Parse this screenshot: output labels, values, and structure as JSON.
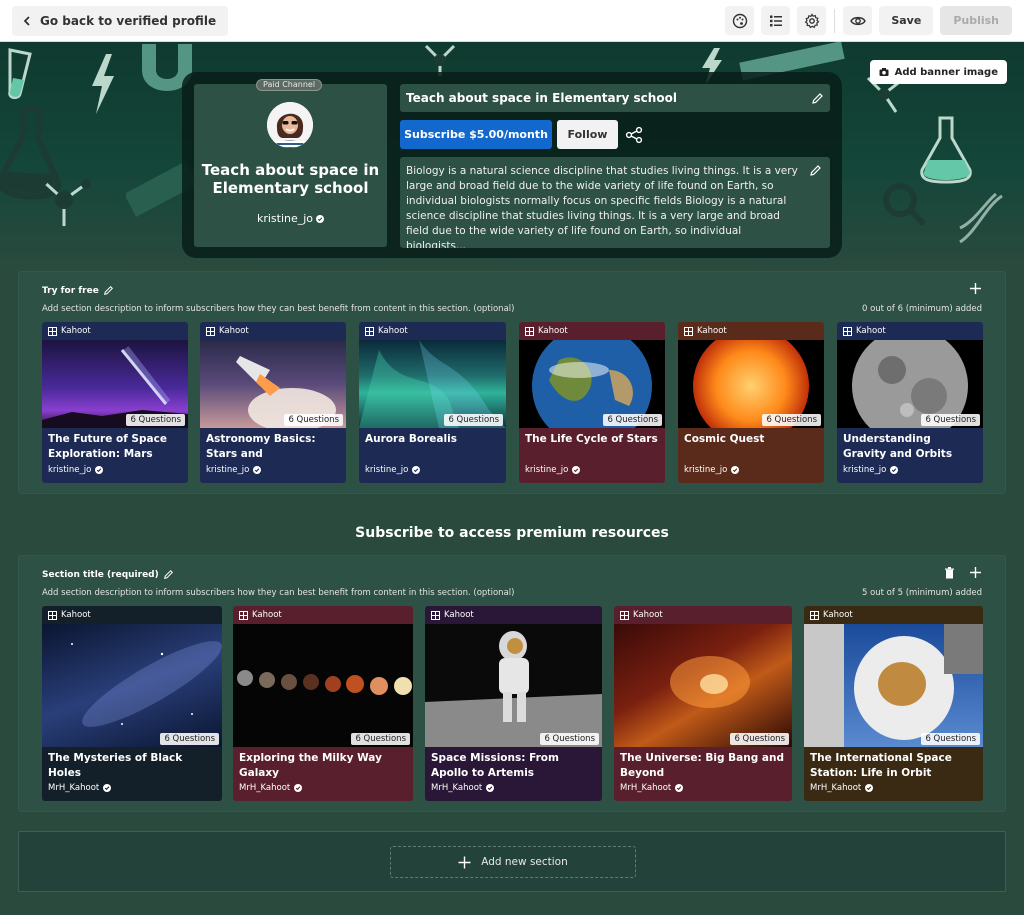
{
  "topbar": {
    "back_label": "Go back to verified profile",
    "save_label": "Save",
    "publish_label": "Publish"
  },
  "banner": {
    "add_banner_label": "Add banner image"
  },
  "channel": {
    "paid_pill": "Paid Channel",
    "title": "Teach about space in Elementary school",
    "author": "kristine_jo",
    "title_field": "Teach about space in Elementary school",
    "subscribe_label": "Subscribe $5.00/month",
    "follow_label": "Follow",
    "description": "Biology is a natural science discipline that studies living things. It is a very large and broad field due to the wide variety of life found on Earth, so individual biologists normally focus on specific fields Biology is a natural science discipline that studies living things. It is a very large and broad field due to the wide variety of life found on Earth, so individual biologists..."
  },
  "free_section": {
    "title": "Try for free",
    "description": "Add section description to inform subscribers how they can best benefit from content in this section. (optional)",
    "count": "0 out of 6 (minimum) added",
    "cards": [
      {
        "label": "Kahoot",
        "questions": "6 Questions",
        "title": "The Future of Space Exploration: Mars and...",
        "author": "kristine_jo"
      },
      {
        "label": "Kahoot",
        "questions": "6 Questions",
        "title": "Astronomy Basics: Stars and Constellations",
        "author": "kristine_jo"
      },
      {
        "label": "Kahoot",
        "questions": "6 Questions",
        "title": "Aurora Borealis",
        "author": "kristine_jo"
      },
      {
        "label": "Kahoot",
        "questions": "6 Questions",
        "title": "The Life Cycle of Stars",
        "author": "kristine_jo"
      },
      {
        "label": "Kahoot",
        "questions": "6 Questions",
        "title": "Cosmic Quest",
        "author": "kristine_jo"
      },
      {
        "label": "Kahoot",
        "questions": "6 Questions",
        "title": "Understanding Gravity and Orbits",
        "author": "kristine_jo"
      }
    ]
  },
  "premium_heading": "Subscribe to access premium resources",
  "premium_section": {
    "title": "Section title (required)",
    "description": "Add section description to inform subscribers how they can best benefit from content in this section. (optional)",
    "count": "5 out of 5 (minimum) added",
    "cards": [
      {
        "label": "Kahoot",
        "questions": "6 Questions",
        "title": "The Mysteries of Black Holes",
        "author": "MrH_Kahoot"
      },
      {
        "label": "Kahoot",
        "questions": "6 Questions",
        "title": "Exploring the Milky Way Galaxy",
        "author": "MrH_Kahoot"
      },
      {
        "label": "Kahoot",
        "questions": "6 Questions",
        "title": "Space Missions: From Apollo to Artemis",
        "author": "MrH_Kahoot"
      },
      {
        "label": "Kahoot",
        "questions": "6 Questions",
        "title": "The Universe: Big Bang and Beyond",
        "author": "MrH_Kahoot"
      },
      {
        "label": "Kahoot",
        "questions": "6 Questions",
        "title": "The International Space Station: Life in Orbit",
        "author": "MrH_Kahoot"
      }
    ]
  },
  "add_section_label": "Add new section",
  "colors": {
    "background": "#2b4a3e",
    "subscribe_blue": "#1368ce",
    "card_navy": "#1d2a54",
    "card_maroon": "#5a1f2c",
    "card_brown": "#5a2a1a",
    "card_purple": "#2a1636",
    "card_dark": "#142029",
    "card_olive": "#3a2a14"
  }
}
